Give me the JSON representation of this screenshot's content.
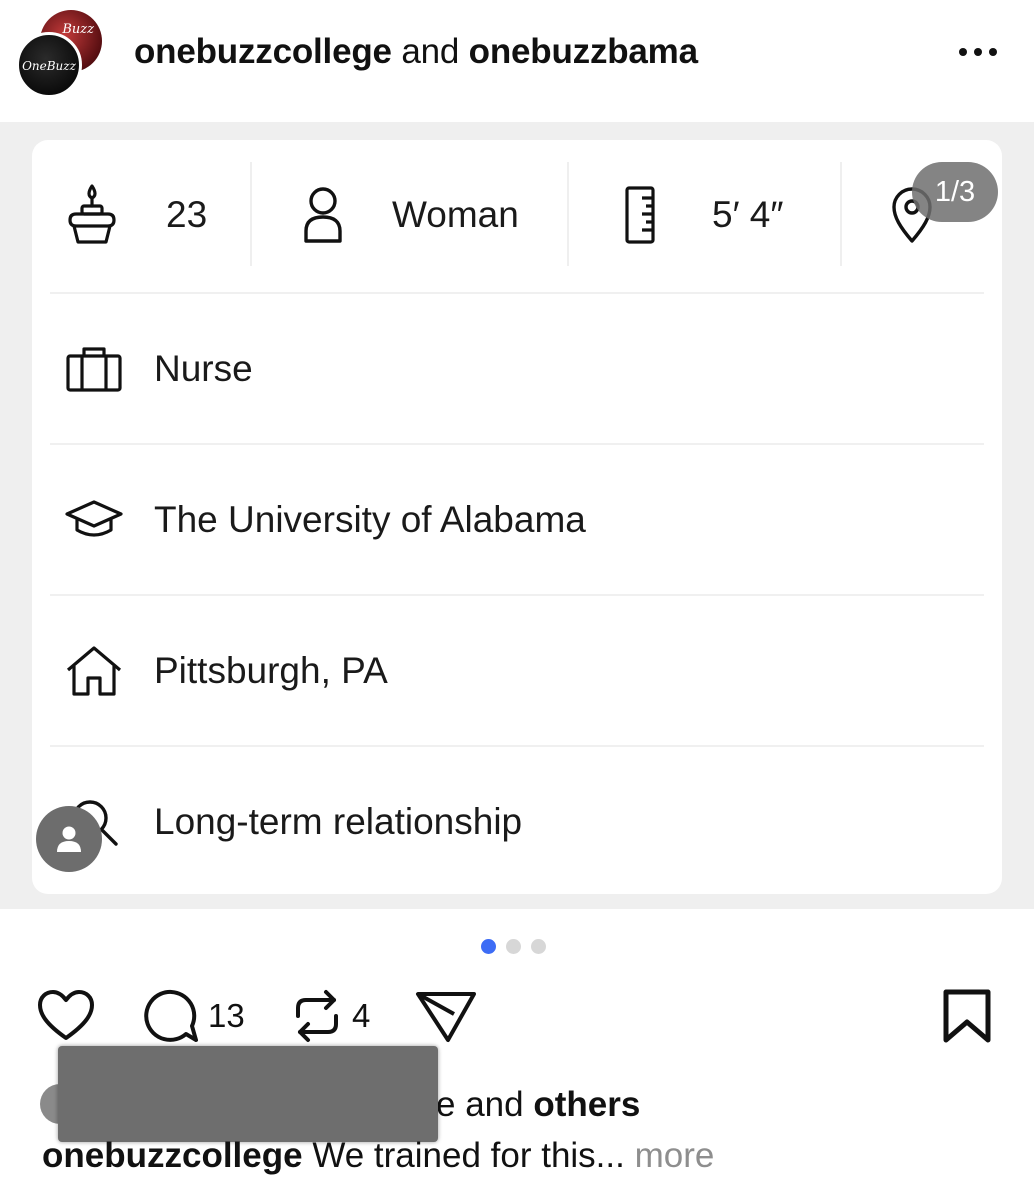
{
  "header": {
    "account_1": "onebuzzcollege",
    "joiner": " and ",
    "account_2": "onebuzzbama",
    "avatar_back_text": "Buzz",
    "avatar_front_text": "OneBuzz"
  },
  "media": {
    "counter": "1/3",
    "stats": [
      {
        "icon": "birthday-cake-icon",
        "label": "23"
      },
      {
        "icon": "person-icon",
        "label": "Woman"
      },
      {
        "icon": "ruler-icon",
        "label": "5′ 4″"
      },
      {
        "icon": "location-pin-icon",
        "label": ""
      }
    ],
    "rows": [
      {
        "icon": "briefcase-icon",
        "label": "Nurse"
      },
      {
        "icon": "graduation-cap-icon",
        "label": "The University of Alabama"
      },
      {
        "icon": "home-icon",
        "label": "Pittsburgh, PA"
      },
      {
        "icon": "search-icon",
        "label": "Long-term relationship"
      }
    ]
  },
  "carousel": {
    "total": 3,
    "active": 1
  },
  "actions": {
    "comment_count": "13",
    "repost_count": "4"
  },
  "likes": {
    "visible_fragment": "e and ",
    "others": "others"
  },
  "caption": {
    "username": "onebuzzcollege",
    "text": " We trained for this... ",
    "more": "more"
  },
  "colors": {
    "accent_dot": "#3d6cf5",
    "media_background": "#efefef",
    "muted_text": "#8e8e8e"
  }
}
